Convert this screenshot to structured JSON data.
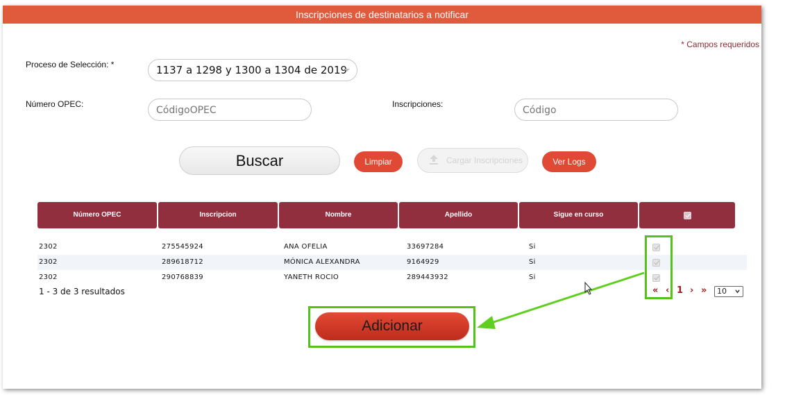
{
  "header": {
    "title": "Inscripciones de destinatarios a notificar"
  },
  "required_note": "* Campos requeridos",
  "form": {
    "proceso_label": "Proceso de Selección: *",
    "proceso_value": "1137 a 1298 y 1300 a 1304 de 2019",
    "opec_label": "Número OPEC:",
    "opec_placeholder": "CódigoOPEC",
    "inscripciones_label": "Inscripciones:",
    "inscripciones_placeholder": "Código"
  },
  "buttons": {
    "buscar": "Buscar",
    "limpiar": "Limpiar",
    "cargar": "Cargar Inscripciones",
    "ver_logs": "Ver Logs",
    "adicionar": "Adicionar"
  },
  "table": {
    "headers": [
      "Número OPEC",
      "Inscripcion",
      "Nombre",
      "Apellido",
      "Sigue en curso"
    ],
    "rows": [
      {
        "opec": "2302",
        "inscripcion": "275545924",
        "nombre": "ANA OFELIA",
        "apellido": "33697284",
        "sigue": "Si",
        "checked": true
      },
      {
        "opec": "2302",
        "inscripcion": "289618712",
        "nombre": "MÓNICA ALEXANDRA",
        "apellido": "9164929",
        "sigue": "Si",
        "checked": true
      },
      {
        "opec": "2302",
        "inscripcion": "290768839",
        "nombre": "YANETH ROCIO",
        "apellido": "289443932",
        "sigue": "Si",
        "checked": true
      }
    ]
  },
  "pagination": {
    "summary": "1 - 3 de 3 resultados",
    "first": "«",
    "prev": "‹",
    "current": "1",
    "next": "›",
    "last": "»",
    "page_size": "10"
  },
  "colors": {
    "title_bar": "#e05a3c",
    "table_header": "#922f3f",
    "primary_red": "#e04a35",
    "highlight": "#55c21a"
  },
  "icons": [
    "upload-icon",
    "checkbox-icon",
    "dropdown-caret-icon",
    "arrow-annotation",
    "mouse-cursor-icon"
  ]
}
